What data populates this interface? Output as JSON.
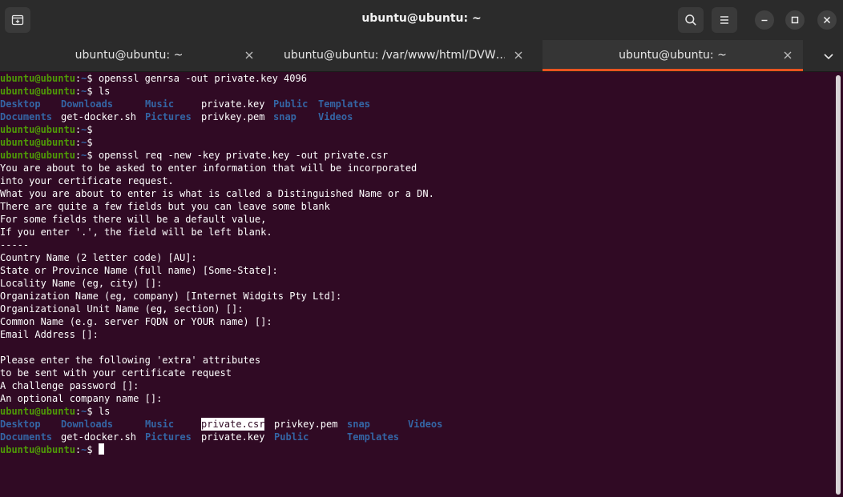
{
  "window": {
    "title": "ubuntu@ubuntu: ~"
  },
  "tabs": [
    {
      "label": "ubuntu@ubuntu: ~",
      "active": false
    },
    {
      "label": "ubuntu@ubuntu: /var/www/html/DVW…",
      "active": false
    },
    {
      "label": "ubuntu@ubuntu: ~",
      "active": true
    }
  ],
  "icons": {
    "new_tab": "new-tab-icon",
    "search": "search-icon",
    "menu": "hamburger-menu-icon",
    "minimize": "minimize-icon",
    "maximize": "maximize-icon",
    "close": "close-icon",
    "tab_close": "close-icon",
    "tab_menu": "chevron-down-icon"
  },
  "colors": {
    "background": "#300a24",
    "prompt_user": "#4e9a06",
    "prompt_path": "#3465a4",
    "directory": "#3465a4",
    "accent": "#e95420"
  },
  "terminal": {
    "prompt_user": "ubuntu@ubuntu",
    "prompt_sep": ":",
    "prompt_path": "~",
    "prompt_symbol": "$",
    "cmd1": " openssl genrsa -out private.key 4096",
    "cmd2": " ls",
    "ls1_row1": [
      "Desktop",
      "Downloads",
      "Music",
      "private.key",
      "Public",
      "Templates"
    ],
    "ls1_row2": [
      "Documents",
      "get-docker.sh",
      "Pictures",
      "privkey.pem",
      "snap",
      "Videos"
    ],
    "cmd3": " openssl req -new -key private.key -out private.csr",
    "output": [
      "You are about to be asked to enter information that will be incorporated",
      "into your certificate request.",
      "What you are about to enter is what is called a Distinguished Name or a DN.",
      "There are quite a few fields but you can leave some blank",
      "For some fields there will be a default value,",
      "If you enter '.', the field will be left blank.",
      "-----",
      "Country Name (2 letter code) [AU]:",
      "State or Province Name (full name) [Some-State]:",
      "Locality Name (eg, city) []:",
      "Organization Name (eg, company) [Internet Widgits Pty Ltd]:",
      "Organizational Unit Name (eg, section) []:",
      "Common Name (e.g. server FQDN or YOUR name) []:",
      "Email Address []:",
      "",
      "Please enter the following 'extra' attributes",
      "to be sent with your certificate request",
      "A challenge password []:",
      "An optional company name []:"
    ],
    "cmd4": " ls",
    "ls2_row1": [
      "Desktop",
      "Downloads",
      "Music",
      "private.csr",
      "privkey.pem",
      "snap",
      "Videos"
    ],
    "ls2_row2": [
      "Documents",
      "get-docker.sh",
      "Pictures",
      "private.key",
      "Public",
      "Templates"
    ]
  }
}
